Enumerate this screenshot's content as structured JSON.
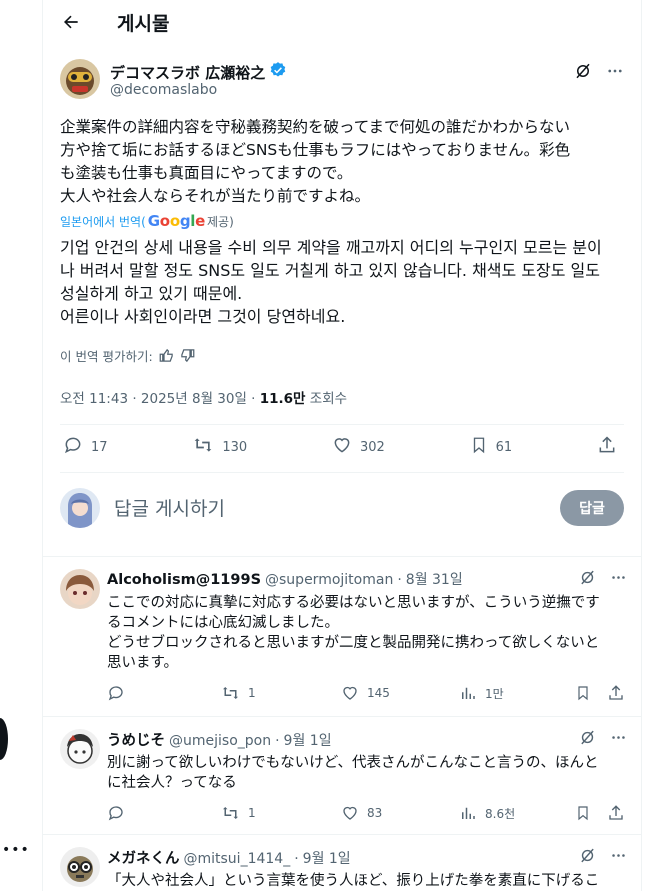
{
  "header": {
    "title": "게시물"
  },
  "post": {
    "author_name": "デコマスラボ 広瀬裕之",
    "author_handle": "@decomaslabo",
    "original_text": "企業案件の詳細内容を守秘義務契約を破ってまで何処の誰だかわからない\n方や捨て垢にお話するほどSNSも仕事もラフにはやっておりません。彩色\nも塗装も仕事も真面目にやってますので。\n大人や社会人ならそれが当たり前ですよね。",
    "translated_from": "일본어에서 번역(",
    "google": "Google",
    "translated_credit": "제공)",
    "translation_text": "기업 안건의 상세 내용을 수비 의무 계약을 깨고까지 어디의 누구인지 모르는 분이\n나 버려서 말할 정도 SNS도 일도 거칠게 하고 있지 않습니다. 채색도 도장도 일도\n성실하게 하고 있기 때문에.\n어른이나 사회인이라면 그것이 당연하네요.",
    "rate_label": "이 번역 평가하기:",
    "time": "오전 11:43 · 2025년 8월 30일 · ",
    "views": "11.6만",
    "views_label": " 조회수",
    "replies": "17",
    "reposts": "130",
    "likes": "302",
    "bookmarks": "61"
  },
  "compose": {
    "placeholder": "답글 게시하기",
    "button": "답글"
  },
  "replies": [
    {
      "name": "Alcoholism@1199S",
      "handle": "@supermojitoman",
      "dot": "·",
      "date": "8월 31일",
      "text": "ここでの対応に真摯に対応する必要はないと思いますが、こういう逆撫です\nるコメントには心底幻滅しました。\nどうせブロックされると思いますが二度と製品開発に携わって欲しくないと\n思います。",
      "replies": "",
      "reposts": "1",
      "likes": "145",
      "views": "1만"
    },
    {
      "name": "うめじそ",
      "handle": "@umejiso_pon",
      "dot": "·",
      "date": "9월 1일",
      "text": "別に謝って欲しいわけでもないけど、代表さんがこんなこと言うの、ほんと\nに社会人？ってなる",
      "replies": "",
      "reposts": "1",
      "likes": "83",
      "views": "8.6천"
    },
    {
      "name": "メガネくん",
      "handle": "@mitsui_1414_",
      "dot": "·",
      "date": "9월 1일",
      "text": "「大人や社会人」という言葉を使う人ほど、振り上げた拳を素直に下げるこ",
      "replies": "",
      "reposts": "",
      "likes": "",
      "views": ""
    }
  ],
  "sidebar": {
    "more": "•••"
  },
  "colors": {
    "accent": "#1d9bf0",
    "text": "#0f1419",
    "muted": "#536471",
    "verified": "#1d9bf0"
  }
}
